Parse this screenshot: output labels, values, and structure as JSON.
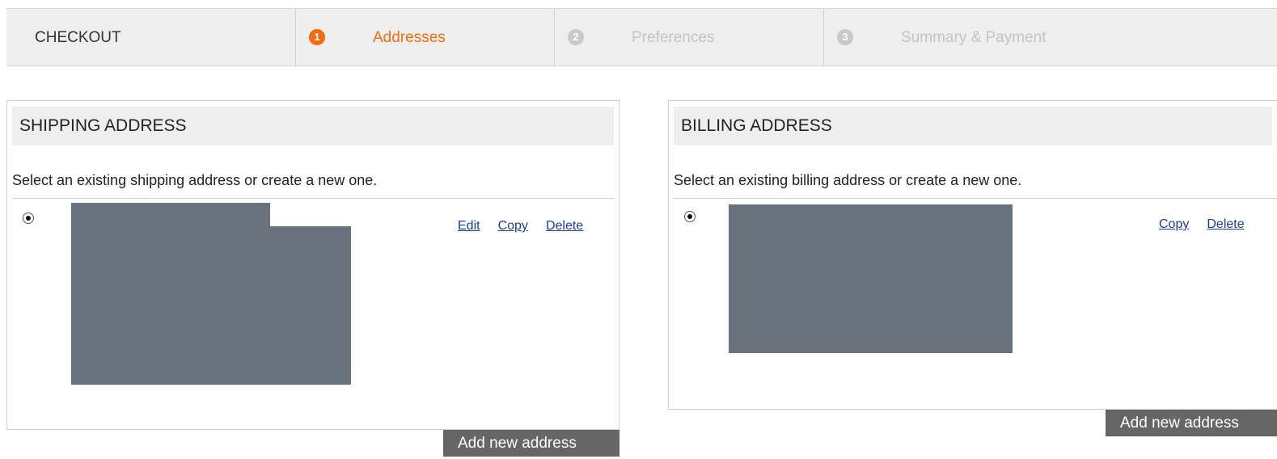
{
  "header": {
    "title": "CHECKOUT",
    "steps": [
      {
        "number": "1",
        "label": "Addresses",
        "state": "active"
      },
      {
        "number": "2",
        "label": "Preferences",
        "state": "inactive"
      },
      {
        "number": "3",
        "label": "Summary & Payment",
        "state": "inactive"
      }
    ]
  },
  "shipping": {
    "title": "SHIPPING ADDRESS",
    "intro": "Select an existing shipping address or create a new one.",
    "actions": {
      "edit": "Edit",
      "copy": "Copy",
      "delete": "Delete"
    },
    "add_button": "Add new address"
  },
  "billing": {
    "title": "BILLING ADDRESS",
    "intro": "Select an existing billing address or create a new one.",
    "actions": {
      "copy": "Copy",
      "delete": "Delete"
    },
    "add_button": "Add new address"
  },
  "colors": {
    "accent": "#f26b10",
    "link": "#1a3e94",
    "redaction": "#68737d",
    "button": "#666666"
  }
}
